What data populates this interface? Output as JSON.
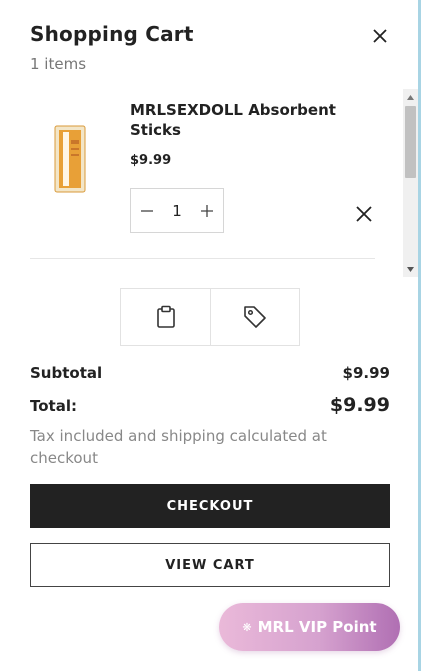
{
  "header": {
    "title": "Shopping Cart",
    "item_count": "1 items"
  },
  "cart_item": {
    "name": "MRLSEXDOLL Absorbent Sticks",
    "price": "$9.99",
    "quantity": "1"
  },
  "summary": {
    "subtotal_label": "Subtotal",
    "subtotal_value": "$9.99",
    "total_label": "Total:",
    "total_value": "$9.99",
    "tax_note": "Tax included and shipping calculated at checkout"
  },
  "actions": {
    "checkout_label": "CHECKOUT",
    "view_cart_label": "VIEW CART"
  },
  "vip": {
    "label": "MRL VIP Point",
    "icon": "gear-flower-icon"
  },
  "icons": [
    "close-icon",
    "minus-icon",
    "plus-icon",
    "remove-icon",
    "clipboard-icon",
    "tag-icon"
  ],
  "colors": {
    "checkout_bg": "#222222",
    "vip_gradient_start": "#eab9d9",
    "vip_gradient_end": "#b06fb3",
    "muted_text": "#888888"
  }
}
